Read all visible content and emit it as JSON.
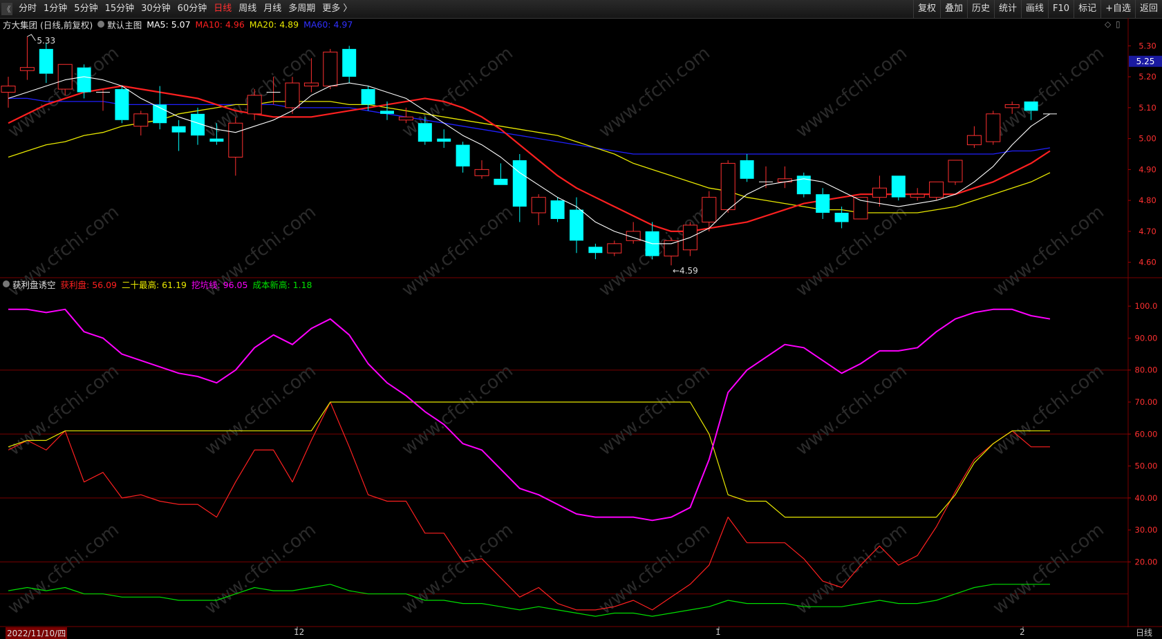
{
  "toolbar": {
    "back_glyph": "《",
    "periods": [
      "分时",
      "1分钟",
      "5分钟",
      "15分钟",
      "30分钟",
      "60分钟",
      "日线",
      "周线",
      "月线",
      "多周期",
      "更多 〉"
    ],
    "active_period": "日线",
    "right_buttons": [
      "复权",
      "叠加",
      "历史",
      "统计",
      "画线",
      "F10",
      "标记",
      "+自选",
      "返回"
    ]
  },
  "main_legend": {
    "stock": "方大集团 (日线,前复权)",
    "template": "默认主图",
    "ma5": "MA5: 5.07",
    "ma10": "MA10: 4.96",
    "ma20": "MA20: 4.89",
    "ma60": "MA60: 4.97"
  },
  "sub_legend": {
    "name": "获利盘诱空",
    "profit": "获利盘: 56.09",
    "high20": "二十最高: 61.19",
    "dig": "挖坑线: 96.05",
    "cost": "成本新高: 1.18"
  },
  "colors": {
    "up": "#ff3030",
    "down": "#00ffff",
    "ma5": "#ffffff",
    "ma10": "#ff2020",
    "ma20": "#e8e800",
    "ma60": "#2020ff",
    "profit": "#ff2020",
    "high20": "#e8e800",
    "dig": "#ff00ff",
    "cost": "#00e000",
    "grid": "#7a0000"
  },
  "date_axis": {
    "labels": [
      "2022/11/10/四",
      "12",
      "1",
      "2"
    ],
    "period_label": "日线"
  },
  "chart_data": [
    {
      "type": "candlestick",
      "ylim": [
        4.55,
        5.35
      ],
      "y_ticks": [
        "5.30",
        "5.20",
        "5.10",
        "5.00",
        "4.90",
        "4.80",
        "4.70",
        "4.60"
      ],
      "current_price_label": "5.25",
      "high_annotation": "5.33",
      "low_annotation": "4.59",
      "candles": [
        {
          "o": 5.15,
          "h": 5.2,
          "l": 5.1,
          "c": 5.17
        },
        {
          "o": 5.22,
          "h": 5.33,
          "l": 5.19,
          "c": 5.23
        },
        {
          "o": 5.29,
          "h": 5.31,
          "l": 5.18,
          "c": 5.21
        },
        {
          "o": 5.16,
          "h": 5.24,
          "l": 5.14,
          "c": 5.24
        },
        {
          "o": 5.23,
          "h": 5.24,
          "l": 5.13,
          "c": 5.15
        },
        {
          "o": 5.15,
          "h": 5.16,
          "l": 5.09,
          "c": 5.15
        },
        {
          "o": 5.16,
          "h": 5.17,
          "l": 5.05,
          "c": 5.06
        },
        {
          "o": 5.04,
          "h": 5.09,
          "l": 5.01,
          "c": 5.08
        },
        {
          "o": 5.11,
          "h": 5.17,
          "l": 5.03,
          "c": 5.05
        },
        {
          "o": 5.04,
          "h": 5.06,
          "l": 4.96,
          "c": 5.02
        },
        {
          "o": 5.08,
          "h": 5.1,
          "l": 4.98,
          "c": 5.01
        },
        {
          "o": 5.0,
          "h": 5.05,
          "l": 4.98,
          "c": 4.99
        },
        {
          "o": 4.94,
          "h": 5.07,
          "l": 4.88,
          "c": 5.05
        },
        {
          "o": 5.08,
          "h": 5.16,
          "l": 5.06,
          "c": 5.14
        },
        {
          "o": 5.15,
          "h": 5.2,
          "l": 5.11,
          "c": 5.15
        },
        {
          "o": 5.1,
          "h": 5.2,
          "l": 5.08,
          "c": 5.18
        },
        {
          "o": 5.17,
          "h": 5.26,
          "l": 5.15,
          "c": 5.18
        },
        {
          "o": 5.17,
          "h": 5.29,
          "l": 5.16,
          "c": 5.28
        },
        {
          "o": 5.29,
          "h": 5.3,
          "l": 5.18,
          "c": 5.2
        },
        {
          "o": 5.16,
          "h": 5.17,
          "l": 5.09,
          "c": 5.11
        },
        {
          "o": 5.09,
          "h": 5.12,
          "l": 5.06,
          "c": 5.08
        },
        {
          "o": 5.06,
          "h": 5.1,
          "l": 5.05,
          "c": 5.07
        },
        {
          "o": 5.05,
          "h": 5.07,
          "l": 4.98,
          "c": 4.99
        },
        {
          "o": 5.0,
          "h": 5.03,
          "l": 4.97,
          "c": 4.99
        },
        {
          "o": 4.98,
          "h": 4.99,
          "l": 4.89,
          "c": 4.91
        },
        {
          "o": 4.88,
          "h": 4.93,
          "l": 4.87,
          "c": 4.9
        },
        {
          "o": 4.87,
          "h": 4.92,
          "l": 4.85,
          "c": 4.85
        },
        {
          "o": 4.93,
          "h": 4.95,
          "l": 4.73,
          "c": 4.78
        },
        {
          "o": 4.76,
          "h": 4.82,
          "l": 4.72,
          "c": 4.81
        },
        {
          "o": 4.8,
          "h": 4.81,
          "l": 4.73,
          "c": 4.74
        },
        {
          "o": 4.77,
          "h": 4.81,
          "l": 4.63,
          "c": 4.67
        },
        {
          "o": 4.65,
          "h": 4.66,
          "l": 4.61,
          "c": 4.63
        },
        {
          "o": 4.63,
          "h": 4.67,
          "l": 4.62,
          "c": 4.66
        },
        {
          "o": 4.67,
          "h": 4.73,
          "l": 4.66,
          "c": 4.7
        },
        {
          "o": 4.7,
          "h": 4.73,
          "l": 4.61,
          "c": 4.62
        },
        {
          "o": 4.62,
          "h": 4.68,
          "l": 4.59,
          "c": 4.67
        },
        {
          "o": 4.64,
          "h": 4.73,
          "l": 4.62,
          "c": 4.72
        },
        {
          "o": 4.73,
          "h": 4.83,
          "l": 4.7,
          "c": 4.81
        },
        {
          "o": 4.77,
          "h": 4.93,
          "l": 4.76,
          "c": 4.92
        },
        {
          "o": 4.93,
          "h": 4.95,
          "l": 4.86,
          "c": 4.87
        },
        {
          "o": 4.86,
          "h": 4.91,
          "l": 4.84,
          "c": 4.86
        },
        {
          "o": 4.86,
          "h": 4.91,
          "l": 4.84,
          "c": 4.87
        },
        {
          "o": 4.88,
          "h": 4.89,
          "l": 4.81,
          "c": 4.82
        },
        {
          "o": 4.82,
          "h": 4.84,
          "l": 4.74,
          "c": 4.76
        },
        {
          "o": 4.76,
          "h": 4.78,
          "l": 4.71,
          "c": 4.73
        },
        {
          "o": 4.74,
          "h": 4.81,
          "l": 4.74,
          "c": 4.81
        },
        {
          "o": 4.81,
          "h": 4.88,
          "l": 4.78,
          "c": 4.84
        },
        {
          "o": 4.88,
          "h": 4.88,
          "l": 4.8,
          "c": 4.81
        },
        {
          "o": 4.81,
          "h": 4.84,
          "l": 4.8,
          "c": 4.82
        },
        {
          "o": 4.81,
          "h": 4.86,
          "l": 4.8,
          "c": 4.86
        },
        {
          "o": 4.86,
          "h": 4.93,
          "l": 4.85,
          "c": 4.93
        },
        {
          "o": 4.98,
          "h": 5.04,
          "l": 4.97,
          "c": 5.01
        },
        {
          "o": 4.99,
          "h": 5.09,
          "l": 4.98,
          "c": 5.08
        },
        {
          "o": 5.1,
          "h": 5.12,
          "l": 5.08,
          "c": 5.11
        },
        {
          "o": 5.12,
          "h": 5.12,
          "l": 5.06,
          "c": 5.09
        },
        {
          "o": 5.08,
          "h": 5.08,
          "l": 5.08,
          "c": 5.08
        }
      ],
      "ma5": [
        5.13,
        5.15,
        5.17,
        5.19,
        5.2,
        5.19,
        5.17,
        5.13,
        5.1,
        5.07,
        5.05,
        5.03,
        5.02,
        5.04,
        5.06,
        5.09,
        5.14,
        5.17,
        5.18,
        5.17,
        5.15,
        5.13,
        5.09,
        5.05,
        5.01,
        4.98,
        4.94,
        4.89,
        4.85,
        4.81,
        4.78,
        4.73,
        4.7,
        4.68,
        4.66,
        4.66,
        4.68,
        4.71,
        4.77,
        4.82,
        4.85,
        4.86,
        4.87,
        4.86,
        4.83,
        4.8,
        4.79,
        4.78,
        4.79,
        4.8,
        4.82,
        4.86,
        4.91,
        4.98,
        5.04,
        5.08
      ],
      "ma10": [
        5.05,
        5.08,
        5.11,
        5.13,
        5.15,
        5.16,
        5.17,
        5.16,
        5.15,
        5.14,
        5.13,
        5.11,
        5.09,
        5.08,
        5.07,
        5.07,
        5.07,
        5.08,
        5.09,
        5.1,
        5.11,
        5.12,
        5.13,
        5.12,
        5.1,
        5.07,
        5.03,
        4.98,
        4.93,
        4.88,
        4.84,
        4.81,
        4.78,
        4.75,
        4.72,
        4.7,
        4.7,
        4.71,
        4.72,
        4.73,
        4.75,
        4.77,
        4.79,
        4.8,
        4.81,
        4.82,
        4.82,
        4.82,
        4.82,
        4.82,
        4.82,
        4.84,
        4.86,
        4.89,
        4.92,
        4.96
      ],
      "ma20": [
        4.94,
        4.96,
        4.98,
        4.99,
        5.01,
        5.02,
        5.04,
        5.05,
        5.06,
        5.08,
        5.09,
        5.1,
        5.11,
        5.11,
        5.12,
        5.12,
        5.12,
        5.12,
        5.11,
        5.11,
        5.1,
        5.09,
        5.08,
        5.07,
        5.06,
        5.05,
        5.04,
        5.03,
        5.02,
        5.01,
        4.99,
        4.97,
        4.95,
        4.92,
        4.9,
        4.88,
        4.86,
        4.84,
        4.83,
        4.81,
        4.8,
        4.79,
        4.78,
        4.77,
        4.77,
        4.76,
        4.76,
        4.76,
        4.76,
        4.77,
        4.78,
        4.8,
        4.82,
        4.84,
        4.86,
        4.89
      ],
      "ma60": [
        5.13,
        5.13,
        5.12,
        5.12,
        5.12,
        5.12,
        5.11,
        5.11,
        5.11,
        5.11,
        5.11,
        5.11,
        5.11,
        5.11,
        5.11,
        5.1,
        5.1,
        5.1,
        5.1,
        5.09,
        5.08,
        5.07,
        5.06,
        5.05,
        5.04,
        5.03,
        5.02,
        5.01,
        5.0,
        4.99,
        4.98,
        4.97,
        4.96,
        4.95,
        4.95,
        4.95,
        4.95,
        4.95,
        4.95,
        4.95,
        4.95,
        4.95,
        4.95,
        4.95,
        4.95,
        4.95,
        4.95,
        4.95,
        4.95,
        4.95,
        4.95,
        4.95,
        4.95,
        4.96,
        4.96,
        4.97
      ]
    },
    {
      "type": "line",
      "ylim": [
        0,
        105
      ],
      "y_ticks": [
        "100.0",
        "90.00",
        "80.00",
        "70.00",
        "60.00",
        "50.00",
        "40.00",
        "30.00",
        "20.00"
      ],
      "series": [
        {
          "name": "获利盘",
          "color": "profit",
          "values": [
            55,
            58,
            55,
            61,
            45,
            48,
            40,
            41,
            39,
            38,
            38,
            34,
            45,
            55,
            55,
            45,
            58,
            70,
            56,
            41,
            39,
            39,
            29,
            29,
            20,
            21,
            15,
            9,
            12,
            7,
            5,
            5,
            6,
            8,
            5,
            9,
            13,
            19,
            34,
            26,
            26,
            26,
            21,
            14,
            12,
            19,
            25,
            19,
            22,
            31,
            42,
            52,
            57,
            61,
            56,
            56
          ]
        },
        {
          "name": "二十最高",
          "color": "high20",
          "values": [
            56,
            58,
            58,
            61,
            61,
            61,
            61,
            61,
            61,
            61,
            61,
            61,
            61,
            61,
            61,
            61,
            61,
            70,
            70,
            70,
            70,
            70,
            70,
            70,
            70,
            70,
            70,
            70,
            70,
            70,
            70,
            70,
            70,
            70,
            70,
            70,
            70,
            60,
            41,
            39,
            39,
            34,
            34,
            34,
            34,
            34,
            34,
            34,
            34,
            34,
            41,
            51,
            57,
            61,
            61,
            61
          ]
        },
        {
          "name": "挖坑线",
          "color": "dig",
          "values": [
            99,
            99,
            98,
            99,
            92,
            90,
            85,
            83,
            81,
            79,
            78,
            76,
            80,
            87,
            91,
            88,
            93,
            96,
            91,
            82,
            76,
            72,
            67,
            63,
            57,
            55,
            49,
            43,
            41,
            38,
            35,
            34,
            34,
            34,
            33,
            34,
            37,
            52,
            73,
            80,
            84,
            88,
            87,
            83,
            79,
            82,
            86,
            86,
            87,
            92,
            96,
            98,
            99,
            99,
            97,
            96
          ]
        },
        {
          "name": "成本新高",
          "color": "cost",
          "values": [
            11,
            12,
            11,
            12,
            10,
            10,
            9,
            9,
            9,
            8,
            8,
            8,
            10,
            12,
            11,
            11,
            12,
            13,
            11,
            10,
            10,
            10,
            8,
            8,
            7,
            7,
            6,
            5,
            6,
            5,
            4,
            3,
            4,
            4,
            3,
            4,
            5,
            6,
            8,
            7,
            7,
            7,
            6,
            6,
            6,
            7,
            8,
            7,
            7,
            8,
            10,
            12,
            13,
            13,
            13,
            13
          ]
        }
      ]
    }
  ]
}
